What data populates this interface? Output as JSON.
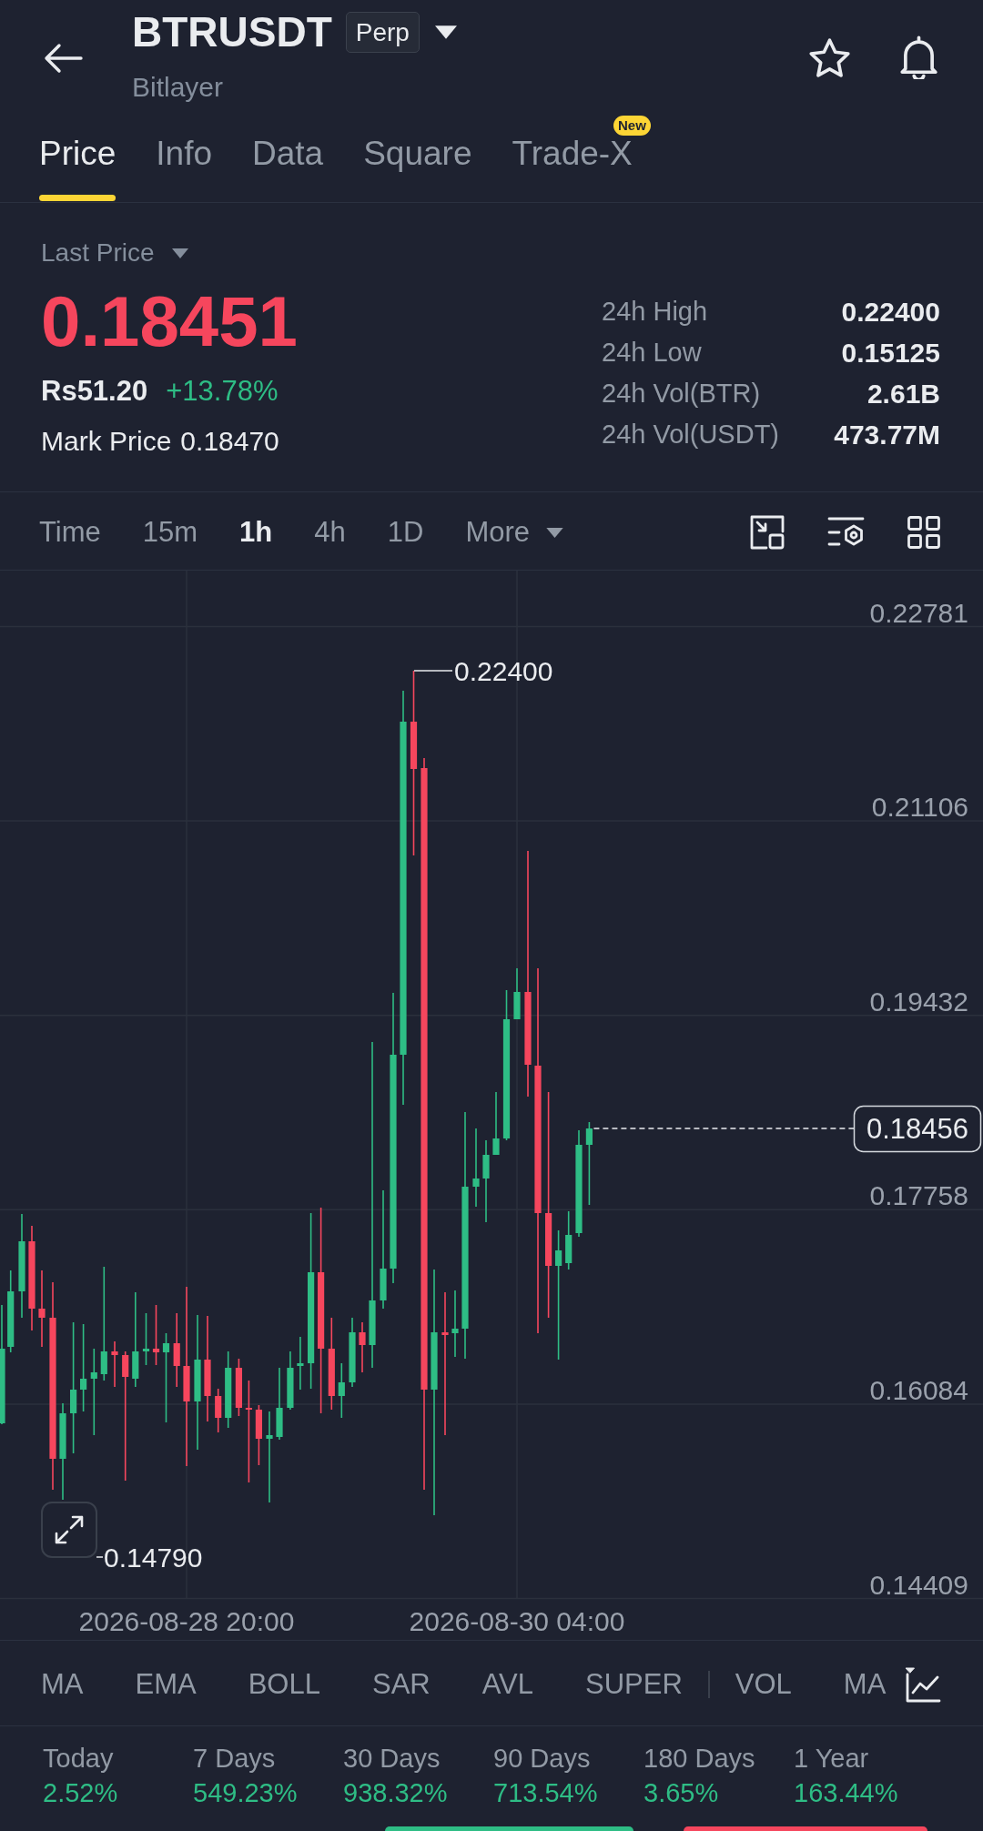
{
  "header": {
    "symbol": "BTRUSDT",
    "badge": "Perp",
    "subtitle": "Bitlayer"
  },
  "tabs": [
    {
      "label": "Price",
      "selected": true
    },
    {
      "label": "Info",
      "selected": false
    },
    {
      "label": "Data",
      "selected": false
    },
    {
      "label": "Square",
      "selected": false
    },
    {
      "label": "Trade-X",
      "selected": false,
      "badge": "New"
    }
  ],
  "price": {
    "selector": "Last Price",
    "last_price": "0.18451",
    "rising": false,
    "local_price": "Rs51.20",
    "change": "+13.78%",
    "mark_label": "Mark Price",
    "mark_value": "0.18470"
  },
  "stats": [
    {
      "label": "24h High",
      "value": "0.22400"
    },
    {
      "label": "24h Low",
      "value": "0.15125"
    },
    {
      "label": "24h Vol(BTR)",
      "value": "2.61B"
    },
    {
      "label": "24h Vol(USDT)",
      "value": "473.77M"
    }
  ],
  "intervals": [
    {
      "label": "Time",
      "kind": "option",
      "selected": false
    },
    {
      "label": "15m",
      "kind": "option",
      "selected": false
    },
    {
      "label": "1h",
      "kind": "option",
      "selected": true
    },
    {
      "label": "4h",
      "kind": "option",
      "selected": false
    },
    {
      "label": "1D",
      "kind": "option",
      "selected": false
    },
    {
      "label": "More",
      "kind": "dropdown",
      "selected": false
    }
  ],
  "chart": {
    "y_labels": [
      "0.22781",
      "0.21106",
      "0.19432",
      "0.17758",
      "0.16084",
      "0.14409"
    ],
    "x_labels": [
      "2026-08-28 20:00",
      "2026-08-30 04:00"
    ],
    "high_label": "0.22400",
    "low_label": "0.14790",
    "current_price": "0.18456"
  },
  "indicators": {
    "main": [
      "MA",
      "EMA",
      "BOLL",
      "SAR",
      "AVL",
      "SUPER"
    ],
    "sub": [
      "VOL",
      "MA"
    ]
  },
  "performance": [
    {
      "label": "Today",
      "value": "2.52%"
    },
    {
      "label": "7 Days",
      "value": "549.23%"
    },
    {
      "label": "30 Days",
      "value": "938.32%"
    },
    {
      "label": "90 Days",
      "value": "713.54%"
    },
    {
      "label": "180 Days",
      "value": "3.65%"
    },
    {
      "label": "1 Year",
      "value": "163.44%"
    }
  ]
}
